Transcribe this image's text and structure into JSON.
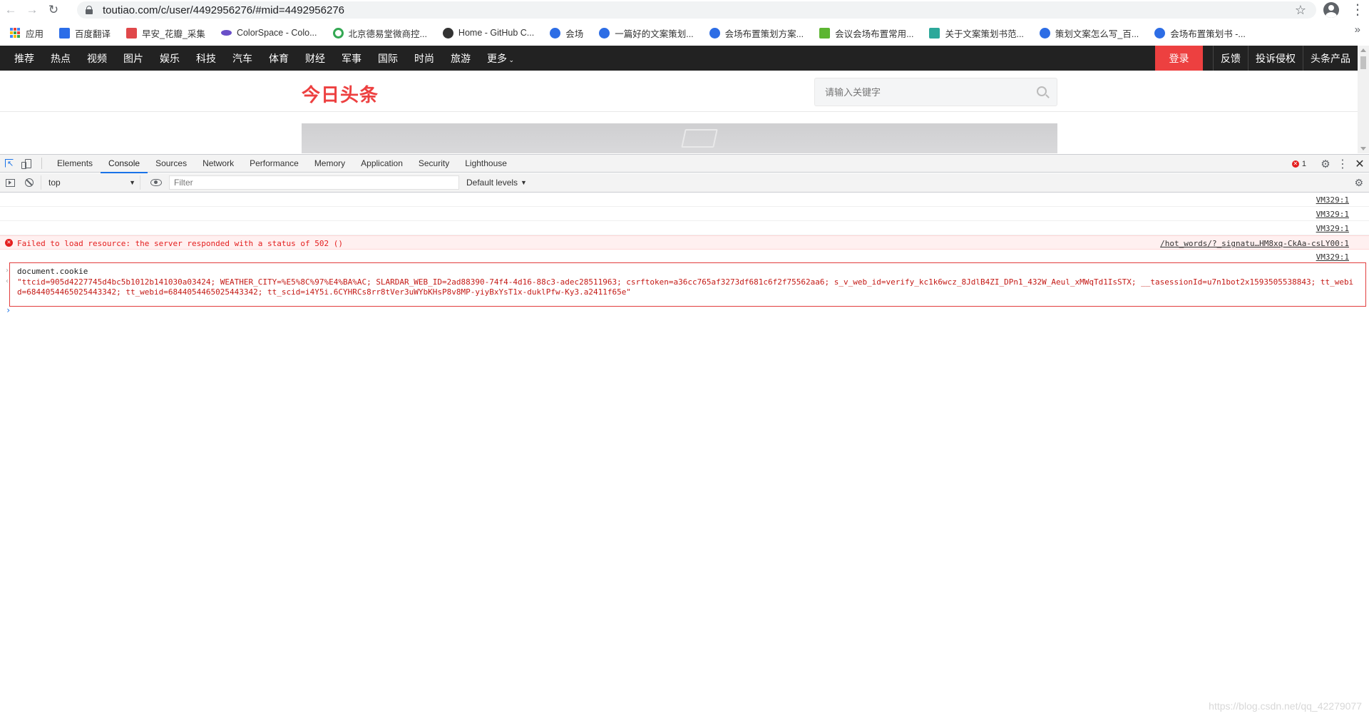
{
  "browser": {
    "url": "toutiao.com/c/user/4492956276/#mid=4492956276",
    "back_icon": "arrow-left-icon",
    "forward_icon": "arrow-right-icon",
    "reload_icon": "reload-icon"
  },
  "bookmarks": [
    {
      "label": "应用",
      "color": "#4285f4"
    },
    {
      "label": "百度翻译",
      "color": "#2b6de8"
    },
    {
      "label": "早安_花瓣_采集",
      "color": "#e0484a"
    },
    {
      "label": "ColorSpace - Colo...",
      "color": "#6a4fc8"
    },
    {
      "label": "北京德易堂微商控...",
      "color": "#34a853"
    },
    {
      "label": "Home - GitHub C...",
      "color": "#333333"
    },
    {
      "label": "会场",
      "color": "#2d6de5"
    },
    {
      "label": "一篇好的文案策划...",
      "color": "#2d6de5"
    },
    {
      "label": "会场布置策划方案...",
      "color": "#2d6de5"
    },
    {
      "label": "会议会场布置常用...",
      "color": "#5cb531"
    },
    {
      "label": "关于文案策划书范...",
      "color": "#2ca89a"
    },
    {
      "label": "策划文案怎么写_百...",
      "color": "#2d6de5"
    },
    {
      "label": "会场布置策划书 -...",
      "color": "#2d6de5"
    }
  ],
  "site": {
    "nav": [
      "推荐",
      "热点",
      "视频",
      "图片",
      "娱乐",
      "科技",
      "汽车",
      "体育",
      "财经",
      "军事",
      "国际",
      "时尚",
      "旅游",
      "更多"
    ],
    "login": "登录",
    "right_links": [
      "反馈",
      "投诉侵权",
      "头条产品"
    ],
    "logo": "今日头条",
    "search_placeholder": "请输入关键字",
    "brand_color": "#ed4040"
  },
  "devtools": {
    "tabs": [
      "Elements",
      "Console",
      "Sources",
      "Network",
      "Performance",
      "Memory",
      "Application",
      "Security",
      "Lighthouse"
    ],
    "active_tab": "Console",
    "error_count": "1",
    "context": "top",
    "filter_placeholder": "Filter",
    "levels": "Default levels"
  },
  "console": {
    "source_links": [
      "VM329:1",
      "VM329:1",
      "VM329:1",
      "/hot_words/?_signatu…HM8xq-CkAa-csLY00:1",
      "VM329:1"
    ],
    "error_message": "Failed to load resource: the server responded with a status of 502 ()",
    "command": "document.cookie",
    "result": "\"ttcid=905d4227745d4bc5b1012b141030a03424; WEATHER_CITY=%E5%8C%97%E4%BA%AC; SLARDAR_WEB_ID=2ad88390-74f4-4d16-88c3-adec28511963; csrftoken=a36cc765af3273df681c6f2f75562aa6; s_v_web_id=verify_kc1k6wcz_8JdlB4ZI_DPn1_432W_Aeul_xMWqTd1IsSTX; __tasessionId=u7n1bot2x1593505538843; tt_webid=6844054465025443342; tt_webid=6844054465025443342; tt_scid=i4Y5i.6CYHRCs8rr8tVer3uWYbKHsP8v8MP-yiyBxYsT1x-duklPfw-Ky3.a2411f65e\""
  },
  "watermark": "https://blog.csdn.net/qq_42279077"
}
